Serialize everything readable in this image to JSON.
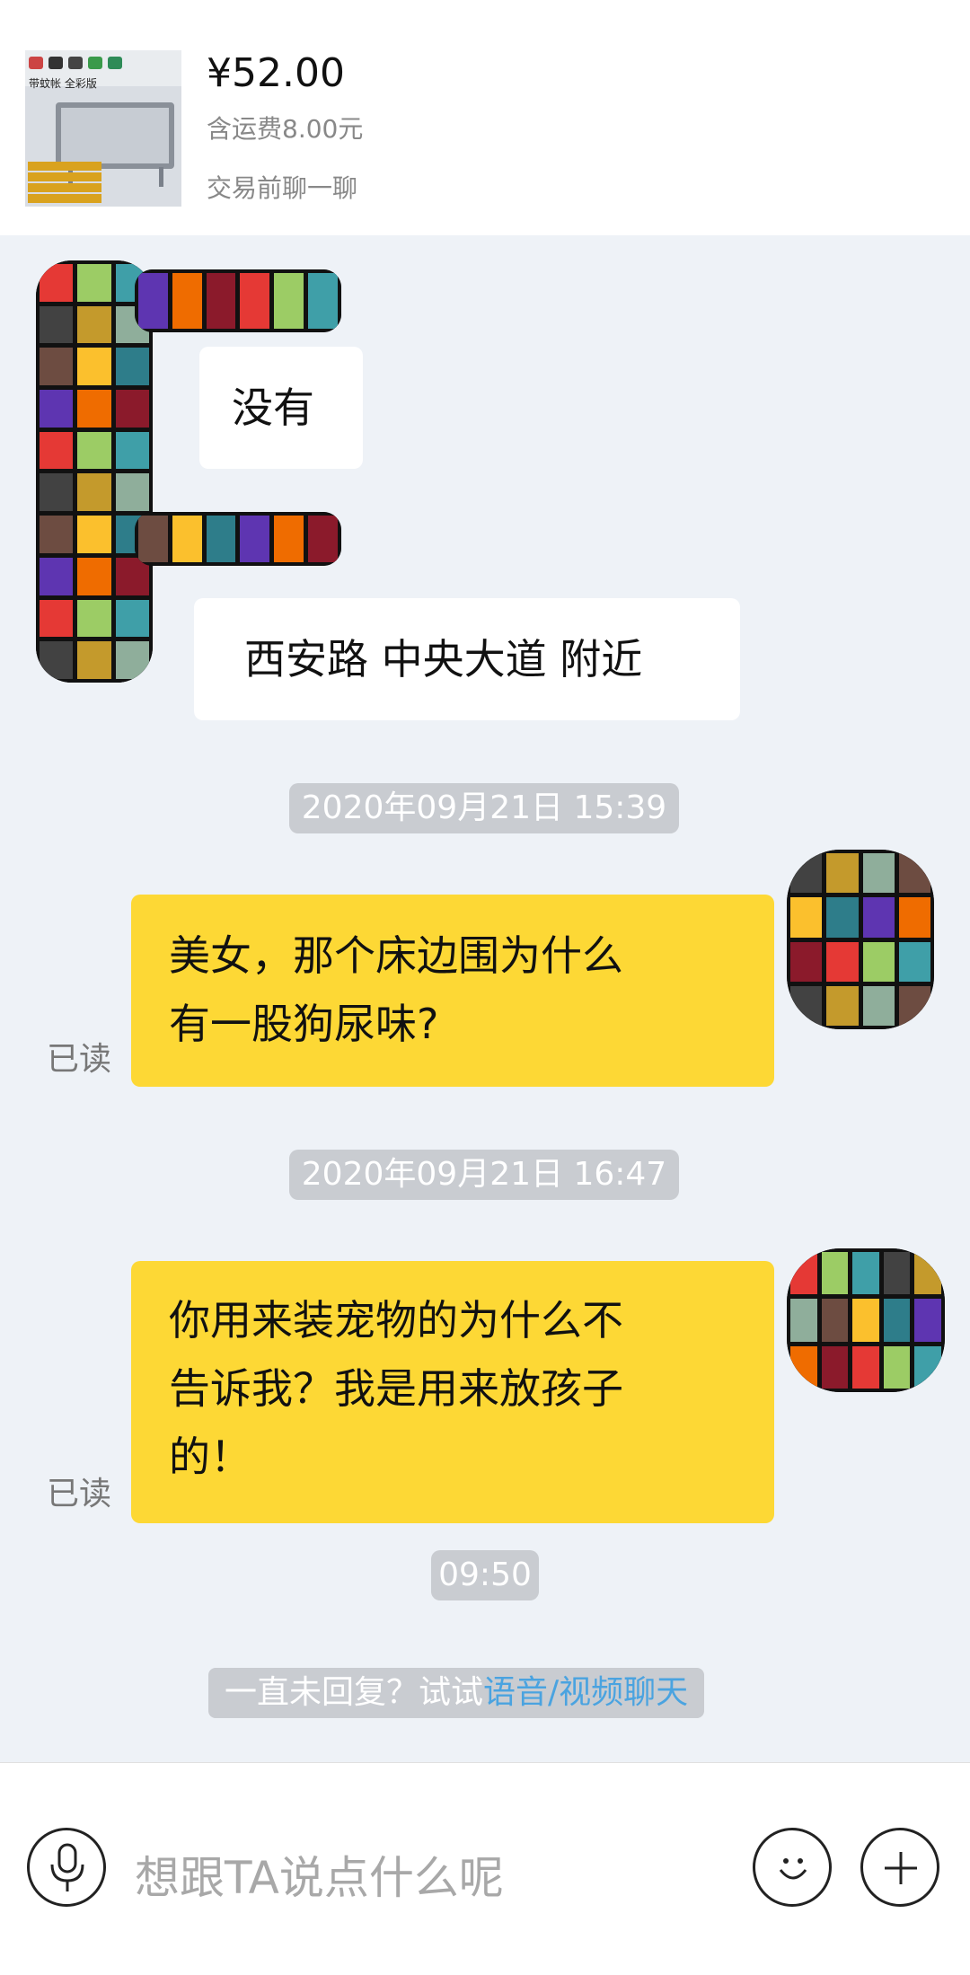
{
  "product": {
    "thumb_caption": "带蚊帐 全彩版",
    "price": "¥52.00",
    "shipping": "含运费8.00元",
    "chat_note": "交易前聊一聊"
  },
  "messages": [
    {
      "side": "in",
      "text": "没有"
    },
    {
      "side": "in",
      "text": "西安路 中央大道 附近"
    },
    {
      "side": "time",
      "text": "2020年09月21日 15:39"
    },
    {
      "side": "out",
      "line1": "美女，那个床边围为什么",
      "line2": "有一股狗尿味?",
      "read": "已读"
    },
    {
      "side": "time",
      "text": "2020年09月21日 16:47"
    },
    {
      "side": "out",
      "line1": "你用来装宠物的为什么不",
      "line2": "告诉我？我是用来放孩子",
      "line3": "的！",
      "read": "已读"
    },
    {
      "side": "time",
      "text": "09:50"
    }
  ],
  "hint": {
    "prefix": "一直未回复？试试",
    "link": "语音/视频聊天"
  },
  "input": {
    "placeholder": "想跟TA说点什么呢",
    "voice_icon": "microphone-icon",
    "emoji_icon": "smiley-icon",
    "more_icon": "plus-icon"
  },
  "colors": {
    "accent_yellow": "#fdd835",
    "link_blue": "#4aa3e0",
    "time_pill": "#c9ccd1"
  }
}
